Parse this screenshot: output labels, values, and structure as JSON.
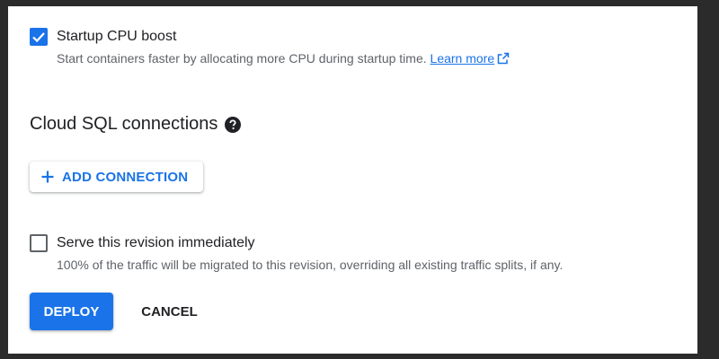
{
  "startup_cpu_boost": {
    "checked": true,
    "label": "Startup CPU boost",
    "description": "Start containers faster by allocating more CPU during startup time.",
    "learn_more": "Learn more",
    "learn_more_icon": "open-in-new-icon"
  },
  "cloud_sql": {
    "title": "Cloud SQL connections",
    "help_icon": "help-circle-icon",
    "add_connection_label": "ADD CONNECTION",
    "add_icon": "plus-icon"
  },
  "serve_revision": {
    "checked": false,
    "label": "Serve this revision immediately",
    "description": "100% of the traffic will be migrated to this revision, overriding all existing traffic splits, if any."
  },
  "actions": {
    "deploy_label": "DEPLOY",
    "cancel_label": "CANCEL"
  },
  "colors": {
    "primary": "#1a73e8",
    "text": "#202124",
    "secondary_text": "#5f6368",
    "backdrop": "#2b2b2b"
  }
}
